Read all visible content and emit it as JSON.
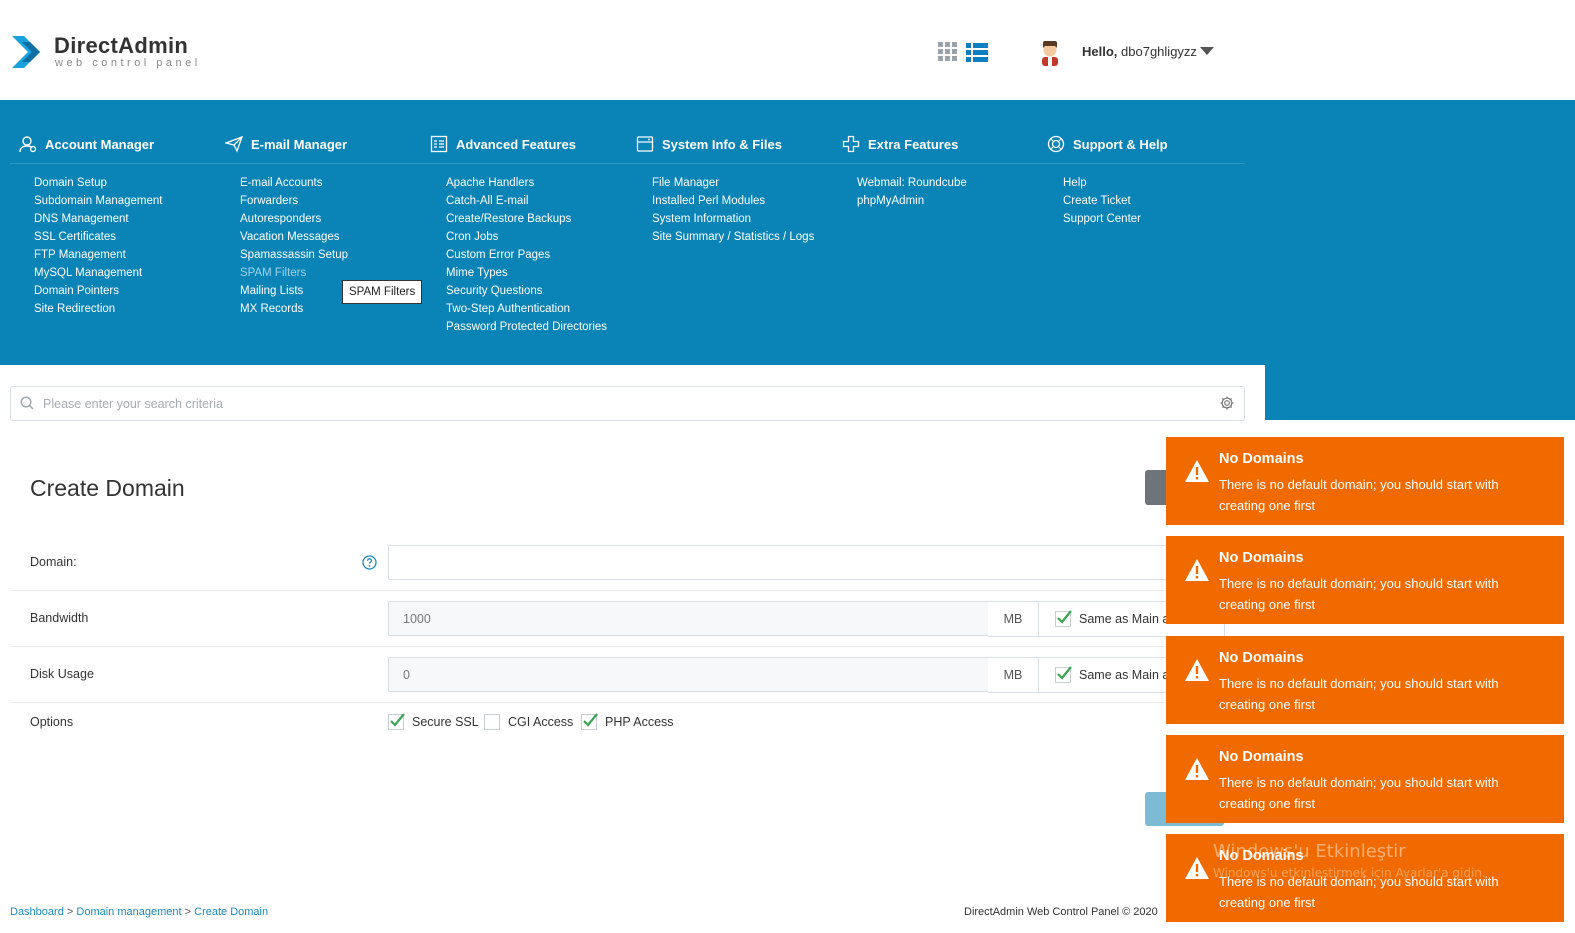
{
  "brand": {
    "title": "DirectAdmin",
    "subtitle": "web control panel"
  },
  "user": {
    "greeting": "Hello,",
    "username": "dbo7ghligyzz"
  },
  "icons": {
    "grid_view": "grid-icon",
    "list_view": "list-icon",
    "user_menu": "caret-down-icon"
  },
  "colors": {
    "nav_bg": "#0a84b7",
    "notification_bg": "#f06a00",
    "link": "#1c8ac0",
    "check": "#3aa655"
  },
  "nav": {
    "columns": [
      {
        "title": "Account Manager",
        "icon": "user-gear-icon",
        "items": [
          "Domain Setup",
          "Subdomain Management",
          "DNS Management",
          "SSL Certificates",
          "FTP Management",
          "MySQL Management",
          "Domain Pointers",
          "Site Redirection"
        ]
      },
      {
        "title": "E-mail Manager",
        "icon": "paper-plane-icon",
        "items": [
          "E-mail Accounts",
          "Forwarders",
          "Autoresponders",
          "Vacation Messages",
          "Spamassassin Setup",
          "SPAM Filters",
          "Mailing Lists",
          "MX Records"
        ]
      },
      {
        "title": "Advanced Features",
        "icon": "list-panel-icon",
        "items": [
          "Apache Handlers",
          "Catch-All E-mail",
          "Create/Restore Backups",
          "Cron Jobs",
          "Custom Error Pages",
          "Mime Types",
          "Security Questions",
          "Two-Step Authentication",
          "Password Protected Directories"
        ]
      },
      {
        "title": "System Info & Files",
        "icon": "drive-icon",
        "items": [
          "File Manager",
          "Installed Perl Modules",
          "System Information",
          "Site Summary / Statistics / Logs"
        ]
      },
      {
        "title": "Extra Features",
        "icon": "plus-cross-icon",
        "items": [
          "Webmail: Roundcube",
          "phpMyAdmin"
        ]
      },
      {
        "title": "Support & Help",
        "icon": "lifebuoy-icon",
        "items": [
          "Help",
          "Create Ticket",
          "Support Center"
        ]
      }
    ],
    "tooltip": "SPAM Filters"
  },
  "search": {
    "placeholder": "Please enter your search criteria"
  },
  "page": {
    "title": "Create Domain"
  },
  "form": {
    "domain_label": "Domain:",
    "domain_value": "",
    "bandwidth_label": "Bandwidth",
    "bandwidth_value": "1000",
    "bandwidth_unit": "MB",
    "bandwidth_same": "Same as Main a",
    "disk_label": "Disk Usage",
    "disk_value": "0",
    "disk_unit": "MB",
    "disk_same": "Same as Main a",
    "options_label": "Options",
    "options": [
      {
        "label": "Secure SSL",
        "checked": true
      },
      {
        "label": "CGI Access",
        "checked": false
      },
      {
        "label": "PHP Access",
        "checked": true
      }
    ]
  },
  "footer": {
    "crumbs": [
      "Dashboard",
      "Domain management",
      "Create Domain"
    ],
    "separator": ">",
    "copyright": "DirectAdmin Web Control Panel © 2020"
  },
  "notifications": [
    {
      "title": "No Domains",
      "body": "There is no default domain; you should start with creating one first"
    },
    {
      "title": "No Domains",
      "body": "There is no default domain; you should start with creating one first"
    },
    {
      "title": "No Domains",
      "body": "There is no default domain; you should start with creating one first"
    },
    {
      "title": "No Domains",
      "body": "There is no default domain; you should start with creating one first"
    },
    {
      "title": "No Domains",
      "body": "There is no default domain; you should start with creating one first"
    }
  ],
  "watermark": {
    "line1": "Windows'u Etkinleştir",
    "line2": "Windows'u etkinleştirmek için Ayarlar'a gidin."
  }
}
